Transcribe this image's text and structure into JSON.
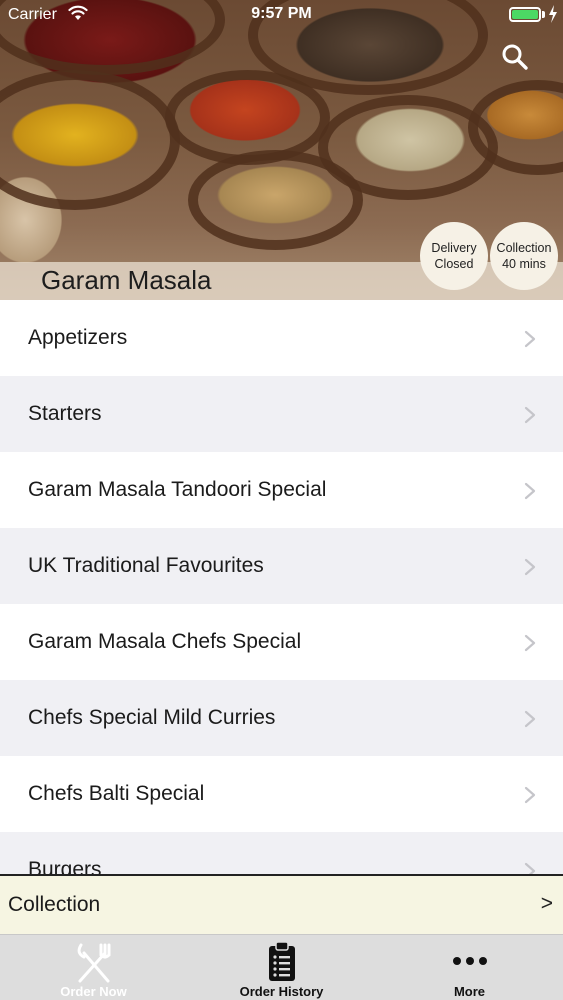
{
  "status_bar": {
    "carrier": "Carrier",
    "time": "9:57 PM",
    "battery_color": "#4cd964"
  },
  "header": {
    "restaurant_name": "Garam Masala",
    "search_icon": "search-icon",
    "delivery_badge": {
      "line1": "Delivery",
      "line2": "Closed"
    },
    "collection_badge": {
      "line1": "Collection",
      "line2": "40 mins"
    }
  },
  "menu": {
    "items": [
      {
        "label": "Appetizers"
      },
      {
        "label": "Starters"
      },
      {
        "label": "Garam Masala Tandoori Special"
      },
      {
        "label": "UK Traditional Favourites"
      },
      {
        "label": "Garam Masala Chefs Special"
      },
      {
        "label": "Chefs Special Mild Curries"
      },
      {
        "label": "Chefs Balti Special"
      },
      {
        "label": "Burgers"
      }
    ],
    "chevron_icon": "chevron-right-icon"
  },
  "collection_bar": {
    "label": "Collection",
    "arrow": ">"
  },
  "tab_bar": {
    "tabs": [
      {
        "label": "Order Now",
        "icon": "fork-knife-icon"
      },
      {
        "label": "Order History",
        "icon": "clipboard-list-icon"
      },
      {
        "label": "More",
        "icon": "more-dots-icon"
      }
    ]
  }
}
